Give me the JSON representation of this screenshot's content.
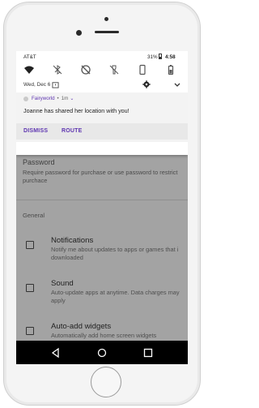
{
  "status_bar": {
    "carrier": "AT&T",
    "battery": "31%",
    "time": "4:58"
  },
  "quick_settings": {
    "icons": [
      "wifi-icon",
      "bluetooth-off-icon",
      "do-not-disturb-off-icon",
      "flashlight-off-icon",
      "portrait-rotation-icon",
      "battery-saver-icon"
    ]
  },
  "date_row": {
    "date": "Wed, Dec 6"
  },
  "notification": {
    "app": "Fairyworld",
    "separator": "•",
    "time": "1m",
    "chevron": "⌄",
    "text": "Joanne has shared her location with you!",
    "actions": [
      "DISMISS",
      "ROUTE"
    ]
  },
  "background_app": {
    "password_title": "Password",
    "password_desc": "Require password for purchase or use password to restrict purchace",
    "section": "General",
    "settings": [
      {
        "title": "Notifications",
        "desc": "Notify me about updates to apps or games that i downloaded"
      },
      {
        "title": "Sound",
        "desc": "Auto-update apps at anytime. Data charges may apply"
      },
      {
        "title": "Auto-add widgets",
        "desc": "Automatically add home screen widgets"
      }
    ]
  },
  "colors": {
    "accent": "#5e35b1",
    "scrim": "#a3a3a3",
    "navbar": "#000000"
  }
}
